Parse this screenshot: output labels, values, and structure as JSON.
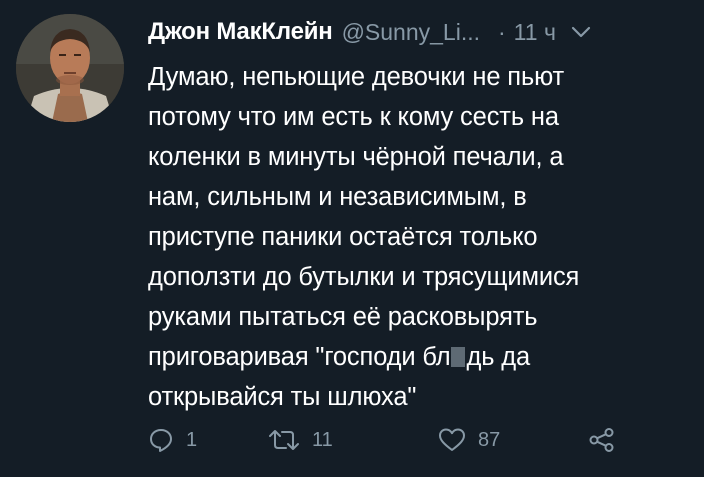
{
  "tweet": {
    "author_name": "Джон МакКлейн",
    "handle": "@Sunny_Li...",
    "separator": "·",
    "time": "11 ч",
    "lines": [
      "Думаю, непьющие девочки не пьют",
      "потому что им есть к кому сесть на",
      "коленки в минуты чёрной печали, а",
      "нам, сильным и независимым, в",
      "приступе паники остаётся только",
      "доползти до бутылки и трясущимися",
      "руками пытаться её расковырять"
    ],
    "line8_before": "приговаривая \"господи бл",
    "line8_after": "дь да",
    "line9": "открывайся ты шлюха\"",
    "replies": "1",
    "retweets": "11",
    "likes": "87"
  },
  "colors": {
    "background": "#141d26",
    "text": "#ffffff",
    "secondary": "#8899a6",
    "censor": "#5e6a74"
  },
  "icons": [
    "reply-icon",
    "retweet-icon",
    "like-icon",
    "share-icon",
    "chevron-down-icon"
  ]
}
